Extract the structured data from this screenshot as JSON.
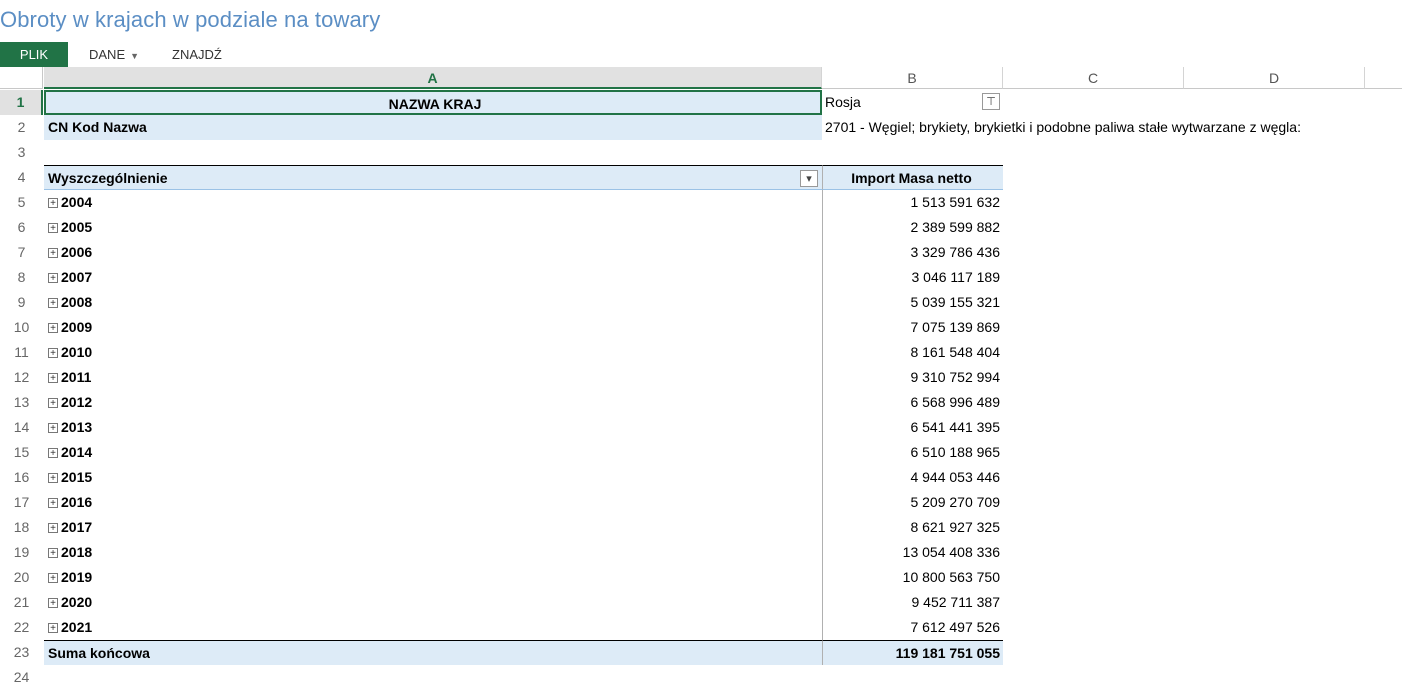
{
  "page": {
    "title": "Obroty w krajach w podziale na towary"
  },
  "ribbon": {
    "plik": "PLIK",
    "dane": "DANE",
    "znajdz": "ZNAJDŹ"
  },
  "columns": [
    "A",
    "B",
    "C",
    "D"
  ],
  "row_numbers": [
    "1",
    "2",
    "3",
    "4",
    "5",
    "6",
    "7",
    "8",
    "9",
    "10",
    "11",
    "12",
    "13",
    "14",
    "15",
    "16",
    "17",
    "18",
    "19",
    "20",
    "21",
    "22",
    "23",
    "24"
  ],
  "pivot": {
    "filter1_label": "NAZWA KRAJ",
    "filter1_value": "Rosja",
    "filter2_label": "CN Kod Nazwa",
    "filter2_value": "2701 - Węgiel; brykiety, brykietki i podobne paliwa stałe wytwarzane z węgla:",
    "row_header": "Wyszczególnienie",
    "value_header": "Import Masa netto",
    "rows": [
      {
        "label": "2004",
        "value": "1 513 591 632"
      },
      {
        "label": "2005",
        "value": "2 389 599 882"
      },
      {
        "label": "2006",
        "value": "3 329 786 436"
      },
      {
        "label": "2007",
        "value": "3 046 117 189"
      },
      {
        "label": "2008",
        "value": "5 039 155 321"
      },
      {
        "label": "2009",
        "value": "7 075 139 869"
      },
      {
        "label": "2010",
        "value": "8 161 548 404"
      },
      {
        "label": "2011",
        "value": "9 310 752 994"
      },
      {
        "label": "2012",
        "value": "6 568 996 489"
      },
      {
        "label": "2013",
        "value": "6 541 441 395"
      },
      {
        "label": "2014",
        "value": "6 510 188 965"
      },
      {
        "label": "2015",
        "value": "4 944 053 446"
      },
      {
        "label": "2016",
        "value": "5 209 270 709"
      },
      {
        "label": "2017",
        "value": "8 621 927 325"
      },
      {
        "label": "2018",
        "value": "13 054 408 336"
      },
      {
        "label": "2019",
        "value": "10 800 563 750"
      },
      {
        "label": "2020",
        "value": "9 452 711 387"
      },
      {
        "label": "2021",
        "value": "7 612 497 526"
      }
    ],
    "total_label": "Suma końcowa",
    "total_value": "119 181 751 055"
  },
  "colors": {
    "accent": "#217346",
    "title": "#5b8ec4",
    "pivot_shade": "#ddebf7"
  }
}
